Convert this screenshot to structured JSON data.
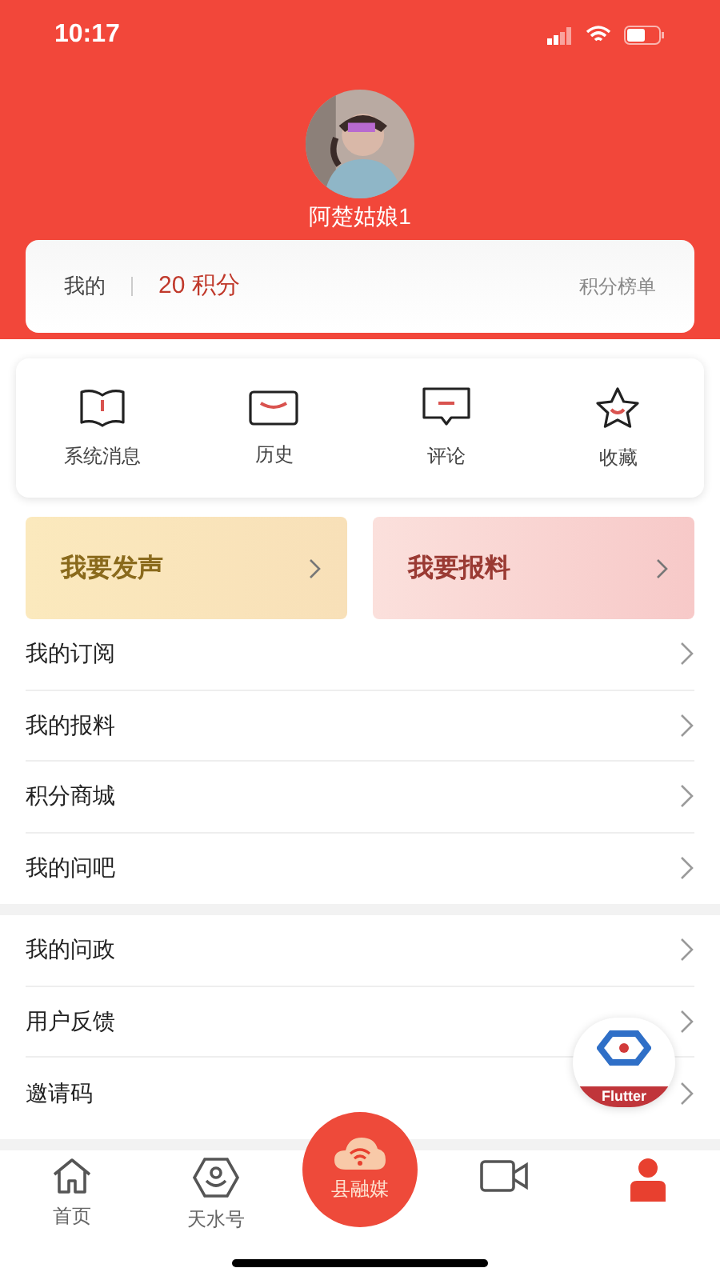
{
  "status_bar": {
    "time": "10:17"
  },
  "profile": {
    "name": "阿楚姑娘1"
  },
  "points": {
    "label": "我的",
    "value": "20 积分",
    "ranking_link": "积分榜单"
  },
  "shortcuts": [
    {
      "label": "系统消息",
      "kind": "book"
    },
    {
      "label": "历史",
      "kind": "mail"
    },
    {
      "label": "评论",
      "kind": "comment"
    },
    {
      "label": "收藏",
      "kind": "star"
    }
  ],
  "banners": [
    {
      "label": "我要发声",
      "kind": "gold"
    },
    {
      "label": "我要报料",
      "kind": "pink"
    }
  ],
  "menu_groups": [
    [
      {
        "label": "我的订阅"
      },
      {
        "label": "我的报料"
      },
      {
        "label": "积分商城"
      },
      {
        "label": "我的问吧"
      }
    ],
    [
      {
        "label": "我的问政"
      },
      {
        "label": "用户反馈"
      },
      {
        "label": "邀请码"
      }
    ]
  ],
  "floating_badge": {
    "label": "Flutter"
  },
  "tab_bar": [
    {
      "label": "首页",
      "kind": "home",
      "selected": false
    },
    {
      "label": "天水号",
      "kind": "hex",
      "selected": false
    },
    {
      "label": "县融媒",
      "kind": "center",
      "selected": false
    },
    {
      "kind": "video",
      "selected": false
    },
    {
      "kind": "person",
      "selected": true
    }
  ]
}
